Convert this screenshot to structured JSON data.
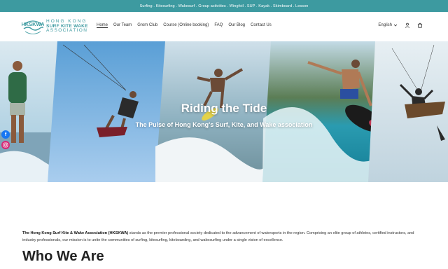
{
  "announcement": "Surfing . Kitesurfing . Wakesurf . Group activities . Wingfoil . SUP . Kayak . Skimboard . Lesson",
  "logo": {
    "emblem_text": "HKSKWA",
    "line1": "HONG KONG",
    "line2": "SURF KITE WAKE",
    "line3": "ASSOCIATION"
  },
  "nav": {
    "items": [
      {
        "label": "Home"
      },
      {
        "label": "Our Team"
      },
      {
        "label": "Grom Club"
      },
      {
        "label": "Course (Online booking)"
      },
      {
        "label": "FAQ"
      },
      {
        "label": "Our Blog"
      },
      {
        "label": "Contact Us"
      }
    ]
  },
  "tools": {
    "language": "English",
    "icons": [
      "chevron-down-icon",
      "account-icon",
      "cart-icon"
    ]
  },
  "hero": {
    "title": "Riding the Tide",
    "subtitle": "The Pulse of Hong Kong's Surf, Kite, and Wake association"
  },
  "social": {
    "icons": [
      "facebook-icon",
      "instagram-icon"
    ],
    "facebook_color": "#1877f2",
    "instagram_color": "#d62976",
    "facebook_glyph": "f"
  },
  "intro": {
    "org_name": "The Hong Kong Surf Kite & Wake Association (HKSKWA)",
    "body": " stands as the premier professional society dedicated to the advancement of watersports in the region. Comprising an elite group of athletes, certified instructors, and industry professionals, our mission is to unite the communities of surfing, kitesurfing, kiteboarding, and wakesurfing under a single vision of excellence."
  },
  "section_title": "Who We Are",
  "colors": {
    "accent": "#3d9aa0",
    "text": "#222222"
  }
}
